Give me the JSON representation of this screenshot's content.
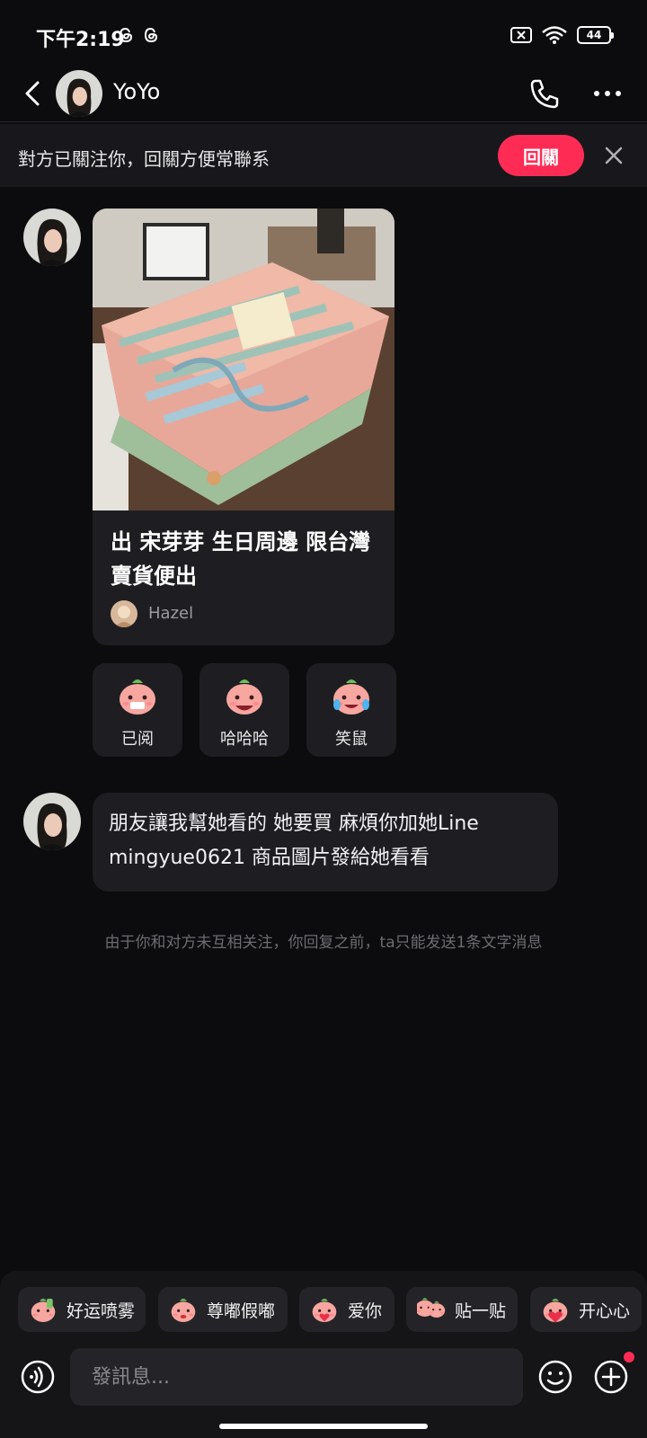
{
  "status_bar": {
    "time": "下午2:19",
    "battery": "44"
  },
  "header": {
    "contact_name": "YoYo"
  },
  "follow_banner": {
    "text": "對方已關注你，回關方便常聯系",
    "button_label": "回關"
  },
  "product_card": {
    "title": "出 宋芽芽 生日周邊 限台灣 賣貨便出",
    "author": "Hazel"
  },
  "reactions": [
    {
      "label": "已阅"
    },
    {
      "label": "哈哈哈"
    },
    {
      "label": "笑鼠"
    }
  ],
  "message": {
    "text": "朋友讓我幫她看的 她要買 麻煩你加她Line mingyue0621 商品圖片發給她看看"
  },
  "system_note": "由于你和对方未互相关注，你回复之前，ta只能发送1条文字消息",
  "quick_stickers": [
    {
      "label": "好运喷雾"
    },
    {
      "label": "尊嘟假嘟"
    },
    {
      "label": "爱你"
    },
    {
      "label": "贴一贴"
    },
    {
      "label": "开心心"
    }
  ],
  "composer": {
    "placeholder": "發訊息..."
  },
  "colors": {
    "accent": "#fe2c55",
    "background": "#0c0c0e",
    "bubble": "#1e1e22"
  }
}
